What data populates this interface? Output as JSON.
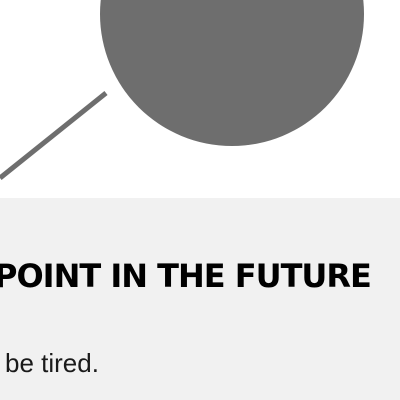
{
  "card": {
    "title": "POINT IN THE FUTURE",
    "body": "be tired."
  },
  "colors": {
    "illustration": "#6e6e6e",
    "card_background": "#f1f1f1",
    "page_background": "#ffffff",
    "text": "#000000"
  },
  "illustration": {
    "icon": "magnifier-illustration"
  }
}
